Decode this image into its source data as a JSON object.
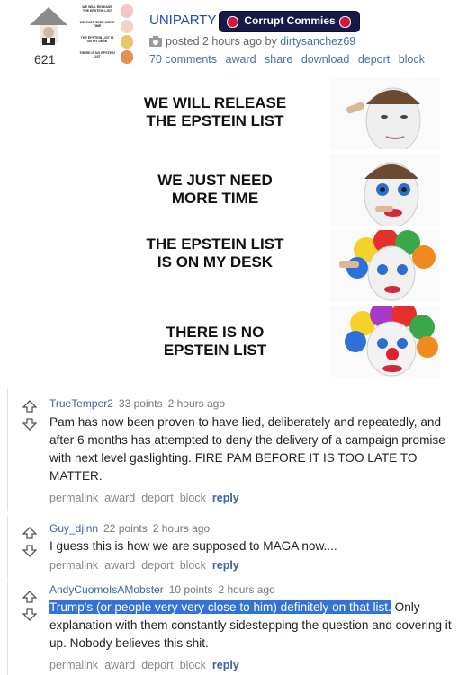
{
  "post": {
    "score": "621",
    "subreddit": "UNIPARTY",
    "flair": "Corrupt Commies",
    "posted_prefix": "posted 2 hours ago by",
    "author": "dirtysanchez69",
    "actions": [
      "70 comments",
      "award",
      "share",
      "download",
      "deport",
      "block"
    ],
    "thumbnail_lines": [
      "WE WILL RELEASE THE EPSTEIN LIST",
      "WE JUST NEED MORE TIME",
      "THE EPSTEIN LIST IS ON MY DESK",
      "THERE IS NO EPSTEIN LIST"
    ]
  },
  "meme": {
    "panels": [
      {
        "text": "WE WILL RELEASE THE EPSTEIN LIST"
      },
      {
        "text": "WE JUST NEED MORE TIME"
      },
      {
        "text": "THE EPSTEIN LIST IS ON MY DESK"
      },
      {
        "text": "THERE IS NO EPSTEIN LIST"
      }
    ]
  },
  "comments": [
    {
      "author": "TrueTemper2",
      "points": "33 points",
      "time": "2 hours ago",
      "body_highlight": "",
      "body": "Pam has now been proven to have lied, deliberately and repeatedly, and after 6 months has attempted to deny the delivery of a campaign promise with next level gaslighting. FIRE PAM BEFORE IT IS TOO LATE TO MATTER.",
      "links": [
        "permalink",
        "award",
        "deport",
        "block"
      ],
      "reply": "reply"
    },
    {
      "author": "Guy_djinn",
      "points": "22 points",
      "time": "2 hours ago",
      "body_highlight": "",
      "body": "I guess this is how we are supposed to MAGA now....",
      "links": [
        "permalink",
        "award",
        "deport",
        "block"
      ],
      "reply": "reply"
    },
    {
      "author": "AndyCuomoIsAMobster",
      "points": "10 points",
      "time": "2 hours ago",
      "body_highlight": "Trump's (or people very very close to him) definitely on that list.",
      "body": " Only explanation with them constantly sidestepping the question and covering it up. Nobody believes this shit.",
      "links": [
        "permalink",
        "award",
        "deport",
        "block"
      ],
      "reply": "reply"
    }
  ],
  "colors": {
    "link_blue": "#1a4db8",
    "flair_bg": "#171a47",
    "flair_dot": "#d5163c",
    "highlight": "#3373d8"
  }
}
